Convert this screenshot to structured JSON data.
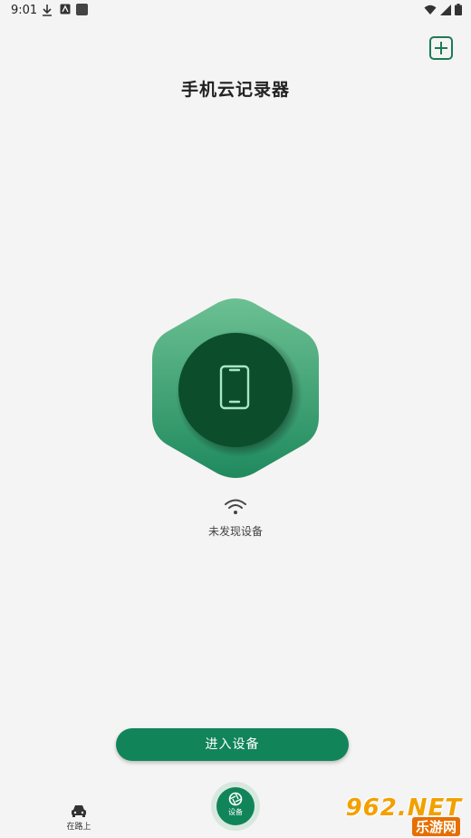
{
  "status_bar": {
    "time": "9:01"
  },
  "header": {
    "title": "手机云记录器",
    "add_icon": "plus-square-icon"
  },
  "device_panel": {
    "icon": "smartphone-icon",
    "colors": {
      "hex_top": "#6cc092",
      "hex_bottom": "#1f8a5e",
      "circle": "#0c4d2c",
      "phone_stroke": "#a9e8c6"
    }
  },
  "connection": {
    "icon": "wifi-icon",
    "status_text": "未发现设备"
  },
  "actions": {
    "enter_label": "进入设备"
  },
  "bottom_nav": {
    "road_label": "在路上",
    "device_label": "设备"
  },
  "watermark": {
    "top": "962.NET",
    "bottom": "乐游网"
  }
}
